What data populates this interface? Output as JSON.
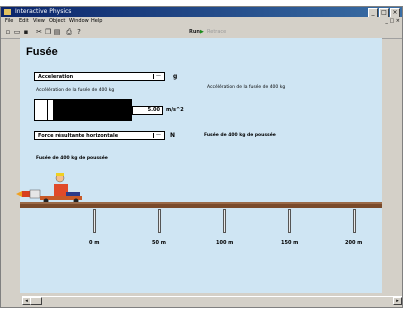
{
  "window": {
    "title": "Interactive Physics"
  },
  "menu": [
    "File",
    "Edit",
    "View",
    "Object",
    "Window",
    "Help"
  ],
  "toolbar": {
    "run_label": "Run",
    "disabled_label": "Retrace"
  },
  "page_title": "Fusée",
  "acceleration": {
    "select_value": "Acceleration",
    "unit_short": "g",
    "caption": "Accélération de la fusée de 400 kg",
    "description": "Accélération de la fusée de 400 kg",
    "value": "5.00",
    "value_unit": "m/s^2",
    "gauge_level": 0.13
  },
  "force": {
    "select_value": "Force résultante horizontale",
    "unit": "N",
    "description": "Fusée de 400 kg de poussée",
    "caption": "Fusée de 400 kg de poussée"
  },
  "track_marks": [
    "0 m",
    "50 m",
    "100 m",
    "150 m",
    "200 m"
  ],
  "colors": {
    "background": "#cfe5f3",
    "track": "#7a4a2a",
    "titlebar": "#0a246a"
  }
}
